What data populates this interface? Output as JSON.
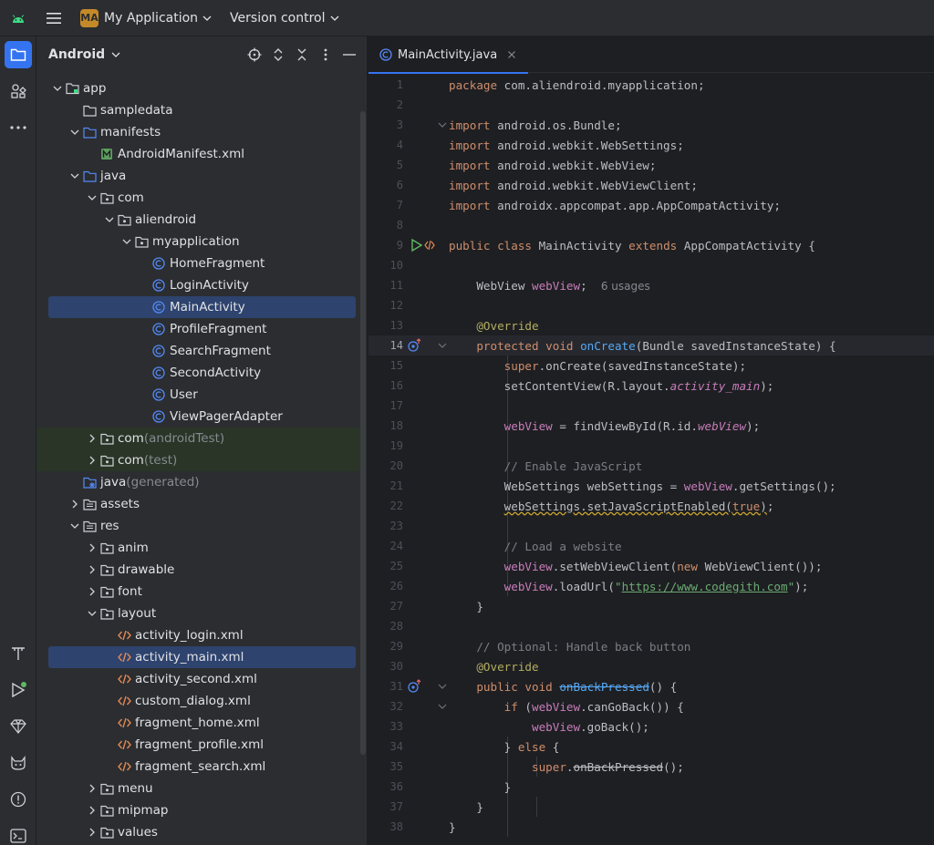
{
  "titlebar": {
    "project_badge": "MA",
    "project_name": "My Application",
    "vcs_label": "Version control"
  },
  "strip": {
    "top": [
      "folder-icon",
      "structure-icon",
      "more-icon"
    ],
    "bottom": [
      "text-icon",
      "run-icon",
      "gem-icon",
      "cat-icon",
      "problems-icon",
      "terminal-icon"
    ]
  },
  "panel": {
    "title": "Android",
    "tree": [
      {
        "label": "app",
        "suffix": "",
        "depth": 0,
        "arrow": "down",
        "icon": "module"
      },
      {
        "label": "sampledata",
        "suffix": "",
        "depth": 1,
        "arrow": "",
        "icon": "folder"
      },
      {
        "label": "manifests",
        "suffix": "",
        "depth": 1,
        "arrow": "down",
        "icon": "folder-blue"
      },
      {
        "label": "AndroidManifest.xml",
        "suffix": "",
        "depth": 2,
        "arrow": "",
        "icon": "manifest"
      },
      {
        "label": "java",
        "suffix": "",
        "depth": 1,
        "arrow": "down",
        "icon": "folder-blue"
      },
      {
        "label": "com",
        "suffix": "",
        "depth": 2,
        "arrow": "down",
        "icon": "package"
      },
      {
        "label": "aliendroid",
        "suffix": "",
        "depth": 3,
        "arrow": "down",
        "icon": "package"
      },
      {
        "label": "myapplication",
        "suffix": "",
        "depth": 4,
        "arrow": "down",
        "icon": "package"
      },
      {
        "label": "HomeFragment",
        "suffix": "",
        "depth": 5,
        "arrow": "",
        "icon": "class"
      },
      {
        "label": "LoginActivity",
        "suffix": "",
        "depth": 5,
        "arrow": "",
        "icon": "class"
      },
      {
        "label": "MainActivity",
        "suffix": "",
        "depth": 5,
        "arrow": "",
        "icon": "class",
        "selected": true
      },
      {
        "label": "ProfileFragment",
        "suffix": "",
        "depth": 5,
        "arrow": "",
        "icon": "class"
      },
      {
        "label": "SearchFragment",
        "suffix": "",
        "depth": 5,
        "arrow": "",
        "icon": "class"
      },
      {
        "label": "SecondActivity",
        "suffix": "",
        "depth": 5,
        "arrow": "",
        "icon": "class"
      },
      {
        "label": "User",
        "suffix": "",
        "depth": 5,
        "arrow": "",
        "icon": "class"
      },
      {
        "label": "ViewPagerAdapter",
        "suffix": "",
        "depth": 5,
        "arrow": "",
        "icon": "class"
      },
      {
        "label": "com",
        "suffix": " (androidTest)",
        "depth": 2,
        "arrow": "right",
        "icon": "package",
        "green": true
      },
      {
        "label": "com",
        "suffix": " (test)",
        "depth": 2,
        "arrow": "right",
        "icon": "package",
        "green": true
      },
      {
        "label": "java",
        "suffix": " (generated)",
        "depth": 1,
        "arrow": "",
        "icon": "folder-gen"
      },
      {
        "label": "assets",
        "suffix": "",
        "depth": 1,
        "arrow": "right",
        "icon": "folder-res"
      },
      {
        "label": "res",
        "suffix": "",
        "depth": 1,
        "arrow": "down",
        "icon": "folder-res"
      },
      {
        "label": "anim",
        "suffix": "",
        "depth": 2,
        "arrow": "right",
        "icon": "package"
      },
      {
        "label": "drawable",
        "suffix": "",
        "depth": 2,
        "arrow": "right",
        "icon": "package"
      },
      {
        "label": "font",
        "suffix": "",
        "depth": 2,
        "arrow": "right",
        "icon": "package"
      },
      {
        "label": "layout",
        "suffix": "",
        "depth": 2,
        "arrow": "down",
        "icon": "package"
      },
      {
        "label": "activity_login.xml",
        "suffix": "",
        "depth": 3,
        "arrow": "",
        "icon": "xml"
      },
      {
        "label": "activity_main.xml",
        "suffix": "",
        "depth": 3,
        "arrow": "",
        "icon": "xml",
        "selected": true
      },
      {
        "label": "activity_second.xml",
        "suffix": "",
        "depth": 3,
        "arrow": "",
        "icon": "xml"
      },
      {
        "label": "custom_dialog.xml",
        "suffix": "",
        "depth": 3,
        "arrow": "",
        "icon": "xml"
      },
      {
        "label": "fragment_home.xml",
        "suffix": "",
        "depth": 3,
        "arrow": "",
        "icon": "xml"
      },
      {
        "label": "fragment_profile.xml",
        "suffix": "",
        "depth": 3,
        "arrow": "",
        "icon": "xml"
      },
      {
        "label": "fragment_search.xml",
        "suffix": "",
        "depth": 3,
        "arrow": "",
        "icon": "xml"
      },
      {
        "label": "menu",
        "suffix": "",
        "depth": 2,
        "arrow": "right",
        "icon": "package"
      },
      {
        "label": "mipmap",
        "suffix": "",
        "depth": 2,
        "arrow": "right",
        "icon": "package"
      },
      {
        "label": "values",
        "suffix": "",
        "depth": 2,
        "arrow": "right",
        "icon": "package"
      }
    ]
  },
  "editor": {
    "tab_label": "MainActivity.java",
    "current_line": 14,
    "lines": [
      {
        "n": "1",
        "tokens": [
          [
            "kw",
            "package "
          ],
          [
            "",
            "com.aliendroid.myapplication;"
          ]
        ]
      },
      {
        "n": "2",
        "tokens": []
      },
      {
        "n": "3",
        "fold": true,
        "tokens": [
          [
            "kw",
            "import "
          ],
          [
            "",
            "android.os.Bundle;"
          ]
        ]
      },
      {
        "n": "4",
        "tokens": [
          [
            "kw",
            "import "
          ],
          [
            "",
            "android.webkit.WebSettings;"
          ]
        ]
      },
      {
        "n": "5",
        "tokens": [
          [
            "kw",
            "import "
          ],
          [
            "",
            "android.webkit.WebView;"
          ]
        ]
      },
      {
        "n": "6",
        "tokens": [
          [
            "kw",
            "import "
          ],
          [
            "",
            "android.webkit.WebViewClient;"
          ]
        ]
      },
      {
        "n": "7",
        "tokens": [
          [
            "kw",
            "import "
          ],
          [
            "",
            "androidx.appcompat.app.AppCompatActivity;"
          ]
        ]
      },
      {
        "n": "8",
        "tokens": []
      },
      {
        "n": "9",
        "gutter": "run",
        "tokens": [
          [
            "kw",
            "public class "
          ],
          [
            "",
            "MainActivity "
          ],
          [
            "kw",
            "extends "
          ],
          [
            "",
            "AppCompatActivity {"
          ]
        ]
      },
      {
        "n": "10",
        "tokens": []
      },
      {
        "n": "11",
        "tokens": [
          [
            "",
            "    WebView "
          ],
          [
            "fld",
            "webView"
          ],
          [
            "",
            ";  "
          ],
          [
            "hint",
            "6 usages"
          ]
        ]
      },
      {
        "n": "12",
        "tokens": []
      },
      {
        "n": "13",
        "tokens": [
          [
            "ann",
            "    @Override"
          ]
        ]
      },
      {
        "n": "14",
        "gutter": "override",
        "fold": true,
        "tokens": [
          [
            "kw",
            "    protected void "
          ],
          [
            "fn",
            "onCreate"
          ],
          [
            "",
            "(Bundle savedInstanceState) {"
          ]
        ]
      },
      {
        "n": "15",
        "tokens": [
          [
            "kw",
            "        super"
          ],
          [
            "",
            ".onCreate(savedInstanceState);"
          ]
        ]
      },
      {
        "n": "16",
        "tokens": [
          [
            "",
            "        setContentView(R.layout."
          ],
          [
            "fld it",
            "activity_main"
          ],
          [
            "",
            ");"
          ]
        ]
      },
      {
        "n": "17",
        "tokens": []
      },
      {
        "n": "18",
        "tokens": [
          [
            "fld",
            "        webView"
          ],
          [
            "",
            " = findViewById(R.id."
          ],
          [
            "fld it",
            "webView"
          ],
          [
            "",
            ");"
          ]
        ]
      },
      {
        "n": "19",
        "tokens": []
      },
      {
        "n": "20",
        "tokens": [
          [
            "com",
            "        // Enable JavaScript"
          ]
        ]
      },
      {
        "n": "21",
        "tokens": [
          [
            "",
            "        WebSettings webSettings = "
          ],
          [
            "fld",
            "webView"
          ],
          [
            "",
            ".getSettings();"
          ]
        ]
      },
      {
        "n": "22",
        "tokens": [
          [
            "",
            "        "
          ],
          [
            "warn",
            "webSettings.setJavaScriptEnabled("
          ],
          [
            "kw warn",
            "true"
          ],
          [
            "warn",
            ")"
          ],
          [
            "",
            ";"
          ]
        ]
      },
      {
        "n": "23",
        "tokens": []
      },
      {
        "n": "24",
        "tokens": [
          [
            "com",
            "        // Load a website"
          ]
        ]
      },
      {
        "n": "25",
        "tokens": [
          [
            "fld",
            "        webView"
          ],
          [
            "",
            ".setWebViewClient("
          ],
          [
            "kw",
            "new "
          ],
          [
            "",
            "WebViewClient());"
          ]
        ]
      },
      {
        "n": "26",
        "tokens": [
          [
            "fld",
            "        webView"
          ],
          [
            "",
            ".loadUrl("
          ],
          [
            "str",
            "\""
          ],
          [
            "str url",
            "https://www.codegith.com"
          ],
          [
            "str",
            "\""
          ],
          [
            "",
            ");"
          ]
        ]
      },
      {
        "n": "27",
        "tokens": [
          [
            "",
            "    }"
          ]
        ]
      },
      {
        "n": "28",
        "tokens": []
      },
      {
        "n": "29",
        "tokens": [
          [
            "com",
            "    // Optional: Handle back button"
          ]
        ]
      },
      {
        "n": "30",
        "tokens": [
          [
            "ann",
            "    @Override"
          ]
        ]
      },
      {
        "n": "31",
        "gutter": "override",
        "fold": true,
        "tokens": [
          [
            "kw",
            "    public void "
          ],
          [
            "fn strike",
            "onBackPressed"
          ],
          [
            "",
            "() {"
          ]
        ]
      },
      {
        "n": "32",
        "fold": true,
        "tokens": [
          [
            "kw",
            "        if "
          ],
          [
            "",
            "("
          ],
          [
            "fld",
            "webView"
          ],
          [
            "",
            ".canGoBack()) {"
          ]
        ]
      },
      {
        "n": "33",
        "tokens": [
          [
            "fld",
            "            webView"
          ],
          [
            "",
            ".goBack();"
          ]
        ]
      },
      {
        "n": "34",
        "tokens": [
          [
            "",
            "        } "
          ],
          [
            "kw",
            "else "
          ],
          [
            "",
            "{"
          ]
        ]
      },
      {
        "n": "35",
        "tokens": [
          [
            "kw",
            "            super"
          ],
          [
            "",
            "."
          ],
          [
            "strike",
            "onBackPressed"
          ],
          [
            "",
            "();"
          ]
        ]
      },
      {
        "n": "36",
        "tokens": [
          [
            "",
            "        }"
          ]
        ]
      },
      {
        "n": "37",
        "tokens": [
          [
            "",
            "    }"
          ]
        ]
      },
      {
        "n": "38",
        "tokens": [
          [
            "",
            "}"
          ]
        ]
      }
    ]
  }
}
